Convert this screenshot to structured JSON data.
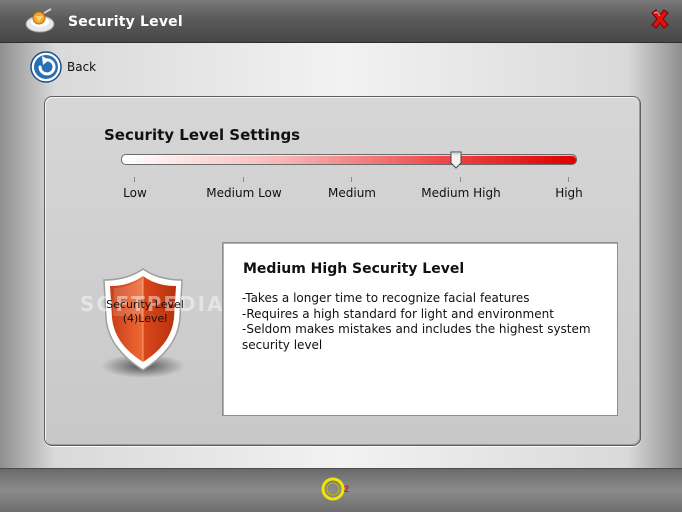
{
  "window": {
    "title": "Security Level"
  },
  "nav": {
    "back_label": "Back"
  },
  "settings": {
    "title": "Security Level Settings",
    "levels": [
      "Low",
      "Medium Low",
      "Medium",
      "Medium High",
      "High"
    ],
    "selected_level": "Medium High",
    "selected_index": 3
  },
  "shield": {
    "line1": "Security Level",
    "line2": "(4)Level"
  },
  "watermark": {
    "text": "SOFTPEDIA"
  },
  "info": {
    "title": "Medium High Security Level",
    "lines": [
      "-Takes a longer time to recognize facial features",
      "-Requires a high standard for light  and environment",
      "-Seldom makes mistakes and includes the highest system security level"
    ]
  },
  "footer": {
    "logo_superscript": "2"
  },
  "colors": {
    "titlebar": "#555555",
    "slider_end": "#dd0000",
    "shield_orange": "#e8552a",
    "close_red": "#e01010",
    "back_blue": "#2a6fb5",
    "footer_logo_yellow": "#f2e600"
  }
}
